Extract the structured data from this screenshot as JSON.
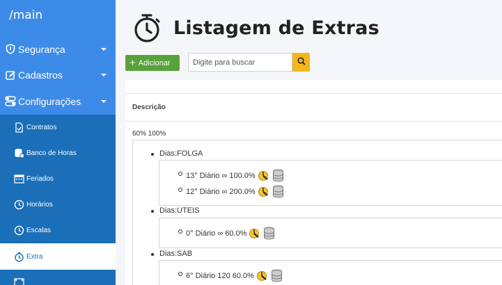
{
  "sidebar": {
    "brand": "/main",
    "menu": [
      {
        "label": "Segurança",
        "icon": "shield-icon"
      },
      {
        "label": "Cadastros",
        "icon": "edit-icon"
      },
      {
        "label": "Configurações",
        "icon": "toggle-icon"
      }
    ],
    "submenu": [
      {
        "label": "Contratos",
        "icon": "contract-icon"
      },
      {
        "label": "Banco de Horas",
        "icon": "database-icon"
      },
      {
        "label": "Feriados",
        "icon": "calendar-icon"
      },
      {
        "label": "Horários",
        "icon": "clock-icon"
      },
      {
        "label": "Escalas",
        "icon": "clock-icon"
      },
      {
        "label": "Extra",
        "icon": "stopwatch-icon",
        "active": true
      }
    ]
  },
  "header": {
    "title": "Listagem de Extras",
    "icon": "stopwatch-icon"
  },
  "toolbar": {
    "add_label": "Adicionar",
    "search_placeholder": "Digite para buscar",
    "search_value": ""
  },
  "table": {
    "column_header": "Descrição",
    "row": {
      "percent_text": "60% 100%",
      "groups": [
        {
          "label": "Dias:FOLGA",
          "entries": [
            "13° Diário ∞ 100.0%",
            "12° Diário ∞ 200.0%"
          ]
        },
        {
          "label": "Dias:UTEIS",
          "entries": [
            "0° Diário ∞ 60.0%"
          ]
        },
        {
          "label": "Dias:SAB",
          "entries": [
            "6° Diário 120 60.0%",
            ""
          ]
        }
      ]
    }
  },
  "colors": {
    "sidebar_bg": "#3d8be8",
    "submenu_bg": "#1a6fb8",
    "add_button": "#58a23a",
    "search_button": "#f2b61e"
  }
}
